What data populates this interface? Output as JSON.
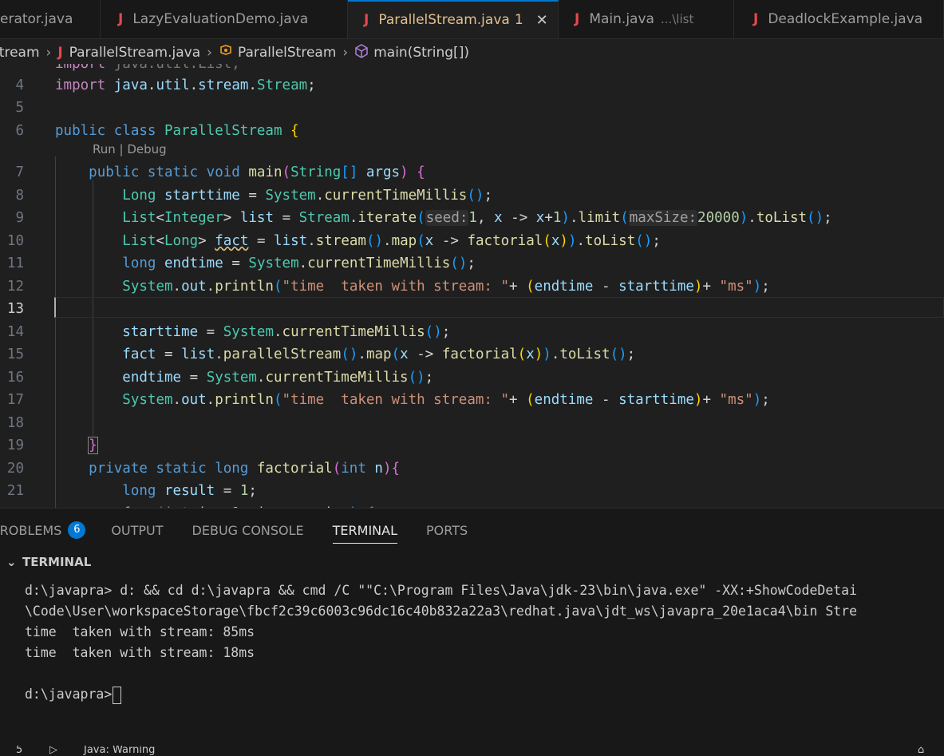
{
  "tabs": [
    {
      "name": "erator.java",
      "active": false
    },
    {
      "name": "LazyEvaluationDemo.java",
      "active": false
    },
    {
      "name": "ParallelStream.java",
      "badge": "1",
      "active": true
    },
    {
      "name": "Main.java",
      "hint": "...\\list",
      "active": false
    },
    {
      "name": "DeadlockExample.java",
      "active": false
    }
  ],
  "breadcrumb": {
    "folder": "Stream",
    "file": "ParallelStream.java",
    "cls": "ParallelStream",
    "method": "main(String[])"
  },
  "codelens": "Run | Debug",
  "code": {
    "line_numbers": [
      "4",
      "5",
      "6",
      "7",
      "8",
      "9",
      "10",
      "11",
      "12",
      "13",
      "14",
      "15",
      "16",
      "17",
      "18",
      "19",
      "20",
      "21"
    ]
  },
  "panel": {
    "tabs": [
      "PROBLEMS",
      "OUTPUT",
      "DEBUG CONSOLE",
      "TERMINAL",
      "PORTS"
    ],
    "problems_count": "6",
    "section_title": "TERMINAL",
    "terminal_lines": [
      "d:\\javapra> d: && cd d:\\javapra && cmd /C \"\"C:\\Program Files\\Java\\jdk-23\\bin\\java.exe\" -XX:+ShowCodeDetai",
      "\\Code\\User\\workspaceStorage\\fbcf2c39c6003c96dc16c40b832a22a3\\redhat.java\\jdt_ws\\javapra_20e1aca4\\bin Stre",
      "time  taken with stream: 85ms",
      "time  taken with stream: 18ms",
      "",
      "d:\\javapra>"
    ]
  },
  "status": {
    "left": "5",
    "warning": "Java: Warning"
  },
  "colors": {
    "accent": "#0078d4",
    "error_tab": "#e2c08d",
    "java_icon": "#e5484d"
  }
}
